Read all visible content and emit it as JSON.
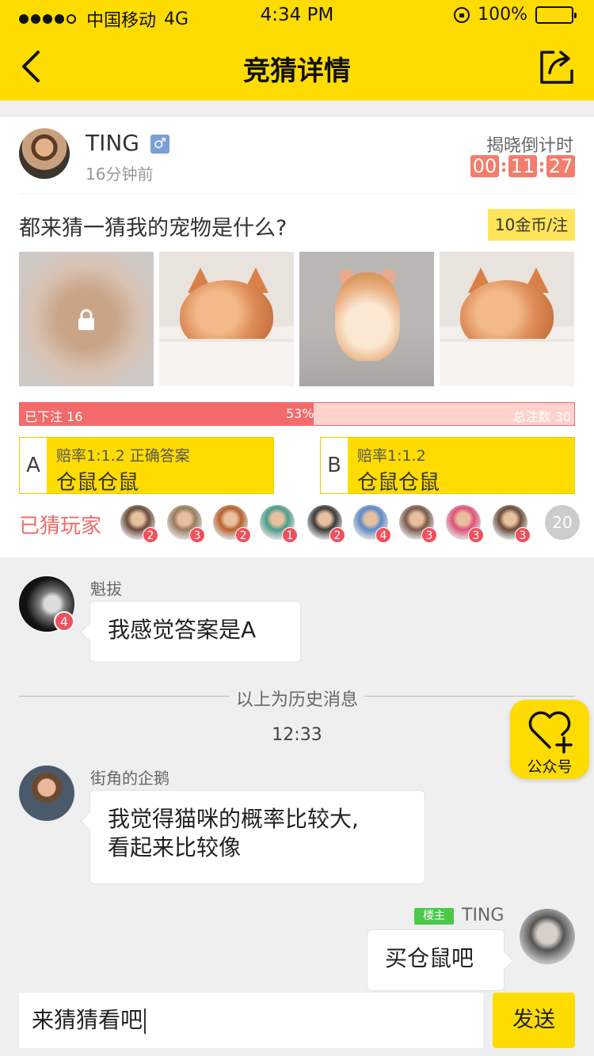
{
  "status_bar": {
    "carrier": "中国移动",
    "network": "4G",
    "time": "4:34 PM",
    "battery": "100%"
  },
  "nav": {
    "title": "竞猜详情"
  },
  "post": {
    "user_name": "TING",
    "gender_symbol": "♂",
    "post_time": "16分钟前",
    "countdown_label": "揭晓倒计时",
    "countdown": [
      "00",
      "11",
      "27"
    ],
    "question": "都来猜一猜我的宠物是什么?",
    "bet_price": "10金币/注",
    "images": [
      "locked",
      "kitten",
      "hamster",
      "kitten"
    ],
    "progress": {
      "bet_label": "已下注 16",
      "percent_label": "53%",
      "percent": 53,
      "total_label": "总注数 30"
    },
    "options": [
      {
        "letter": "A",
        "odds": "赔率1:1.2   正确答案",
        "answer": "仓鼠仓鼠"
      },
      {
        "letter": "B",
        "odds": "赔率1:1.2",
        "answer": "仓鼠仓鼠"
      }
    ],
    "players_label": "已猜玩家",
    "players": [
      {
        "badge": "2",
        "color": "#6b4a3a"
      },
      {
        "badge": "3",
        "color": "#9a7b5e"
      },
      {
        "badge": "2",
        "color": "#b8602a"
      },
      {
        "badge": "1",
        "color": "#4a9c8a"
      },
      {
        "badge": "2",
        "color": "#3a3a3a"
      },
      {
        "badge": "4",
        "color": "#5a8ac8"
      },
      {
        "badge": "3",
        "color": "#7a5a4a"
      },
      {
        "badge": "3",
        "color": "#e0507a"
      },
      {
        "badge": "3",
        "color": "#6a4a3a"
      }
    ],
    "players_count": "20"
  },
  "chat": {
    "messages": [
      {
        "name": "魁拔",
        "text": "我感觉答案是A",
        "badge": "4"
      },
      {
        "name": "街角的企鹅",
        "text_lines": [
          "我觉得猫咪的概率比较大,",
          "看起来比较像"
        ]
      },
      {
        "name": "TING",
        "owner_tag": "楼主",
        "text": "买仓鼠吧"
      }
    ],
    "history_label": "以上为历史消息",
    "time": "12:33"
  },
  "fab": {
    "label": "公众号"
  },
  "input": {
    "value": "来猜猜看吧",
    "send_label": "发送"
  },
  "colors": {
    "brand": "#ffdc00",
    "accent_red": "#f06a6a",
    "countdown": "#f37c6a",
    "owner_green": "#4bc94a"
  }
}
